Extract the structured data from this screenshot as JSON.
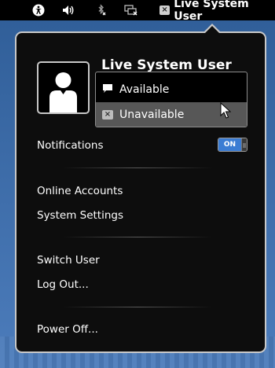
{
  "top_panel": {
    "user_title": "Live System User",
    "icons": [
      "accessibility-icon",
      "volume-icon",
      "bluetooth-disabled-icon",
      "network-disconnected-icon",
      "status-unavailable-icon"
    ]
  },
  "menu": {
    "user_name": "Live System User",
    "status_options": [
      {
        "label": "Available",
        "icon": "chat-bubble-icon"
      },
      {
        "label": "Unavailable",
        "icon": "status-unavailable-icon"
      }
    ],
    "notifications_label": "Notifications",
    "notifications_toggle": "ON",
    "online_accounts": "Online Accounts",
    "system_settings": "System Settings",
    "switch_user": "Switch User",
    "log_out": "Log Out...",
    "power_off": "Power Off..."
  }
}
